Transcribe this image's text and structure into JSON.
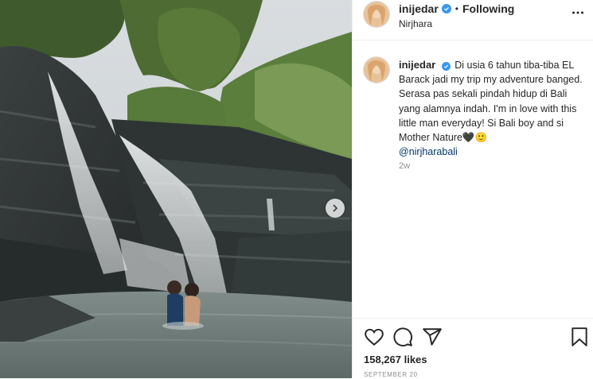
{
  "post": {
    "username": "inijedar",
    "follow_status": "Following",
    "location": "Nirjhara",
    "caption_text": "Di usia 6 tahun tiba-tiba EL Barack jadi my trip my adventure banged. Serasa pas sekali pindah hidup di Bali yang alamnya indah. I'm in love with this little man everyday! Si Bali boy and si Mother Nature🖤🙂",
    "mention": "@nirjharabali",
    "time_ago": "2w",
    "likes": "158,267 likes",
    "date": "SEPTEMBER 20"
  },
  "colors": {
    "verified": "#3897f0",
    "link": "#00376b",
    "muted": "#8e8e8e"
  },
  "icons": {
    "verified": "verified-badge-icon",
    "more": "more-options-icon",
    "next": "chevron-right-icon",
    "like": "heart-icon",
    "comment": "comment-icon",
    "share": "share-icon",
    "save": "bookmark-icon"
  }
}
